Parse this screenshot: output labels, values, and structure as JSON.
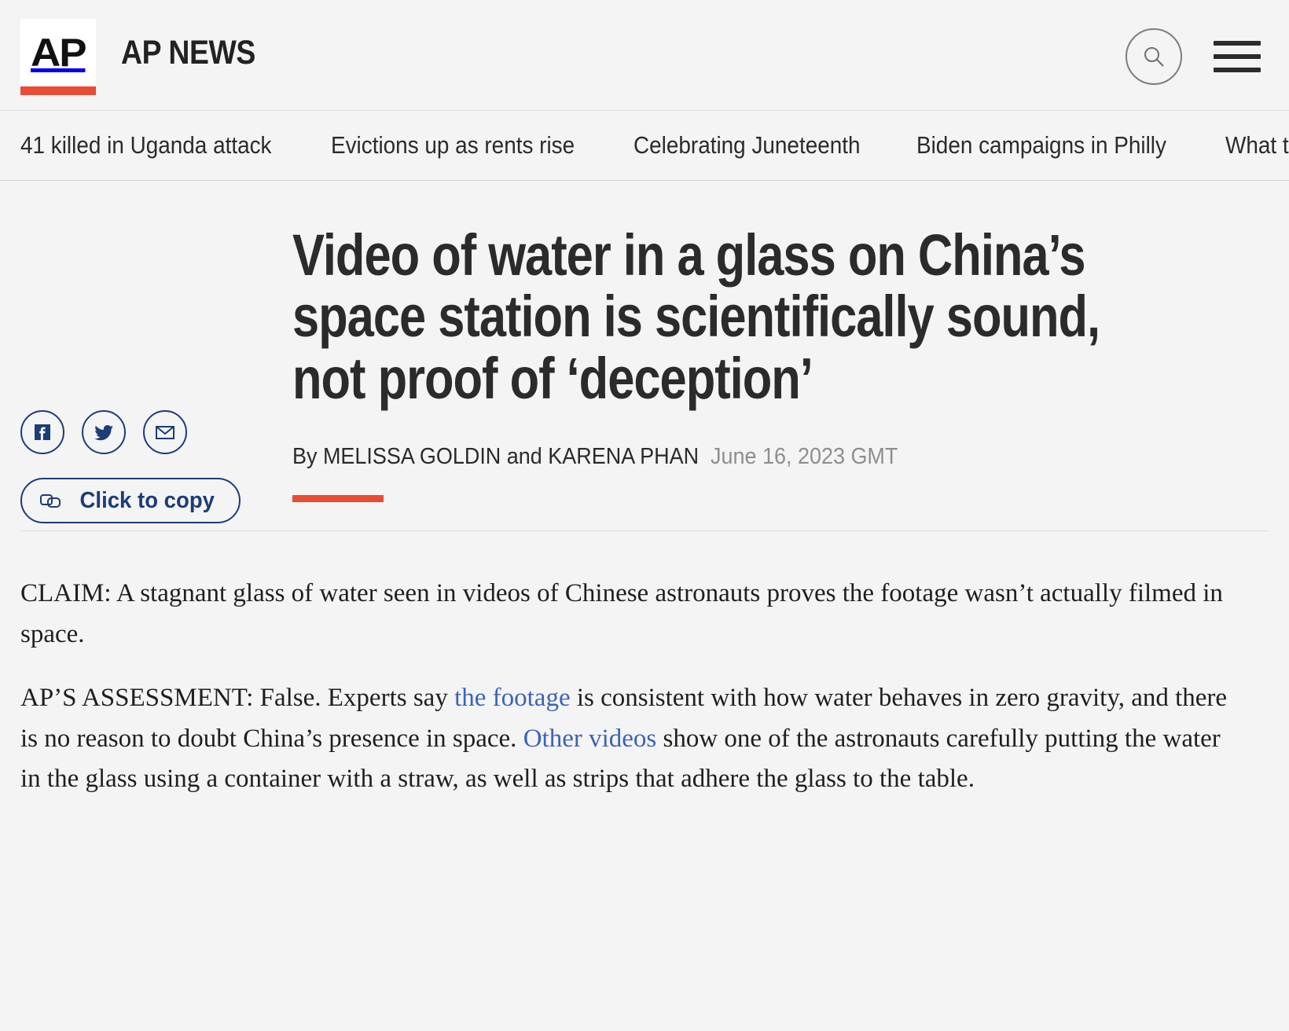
{
  "header": {
    "logo_text": "AP",
    "brand_name": "AP NEWS",
    "search_icon": "search-icon",
    "menu_icon": "hamburger-menu-icon",
    "accent_red": "#e94c35"
  },
  "topic_nav": {
    "items": [
      {
        "label": "41 killed in Uganda attack"
      },
      {
        "label": "Evictions up as rents rise"
      },
      {
        "label": "Celebrating Juneteenth"
      },
      {
        "label": "Biden campaigns in Philly"
      },
      {
        "label": "What to stream"
      }
    ]
  },
  "article": {
    "headline": "Video of water in a glass on China’s space station is scientifically sound, not proof of ‘deception’",
    "byline": "By MELISSA GOLDIN and KARENA PHAN",
    "date": "June 16, 2023 GMT"
  },
  "share": {
    "facebook_icon": "facebook-icon",
    "twitter_icon": "twitter-icon",
    "email_icon": "email-icon",
    "copy_icon": "copy-link-icon",
    "copy_label": "Click to copy",
    "accent_blue": "#1d3c78"
  },
  "body": {
    "link_color": "#3a63b8",
    "paragraphs": [
      {
        "segments": [
          {
            "type": "text",
            "text": "CLAIM: A stagnant glass of water seen in videos of Chinese astronauts proves the footage wasn’t actually filmed in space."
          }
        ]
      },
      {
        "segments": [
          {
            "type": "text",
            "text": "AP’S ASSESSMENT: False. Experts say "
          },
          {
            "type": "link",
            "text": "the footage"
          },
          {
            "type": "text",
            "text": " is consistent with how water behaves in zero gravity, and there is no reason to doubt China’s presence in space. "
          },
          {
            "type": "link",
            "text": "Other videos"
          },
          {
            "type": "text",
            "text": " show one of the astronauts carefully putting the water in the glass using a container with a straw, as well as strips that adhere the glass to the table."
          }
        ]
      }
    ]
  }
}
